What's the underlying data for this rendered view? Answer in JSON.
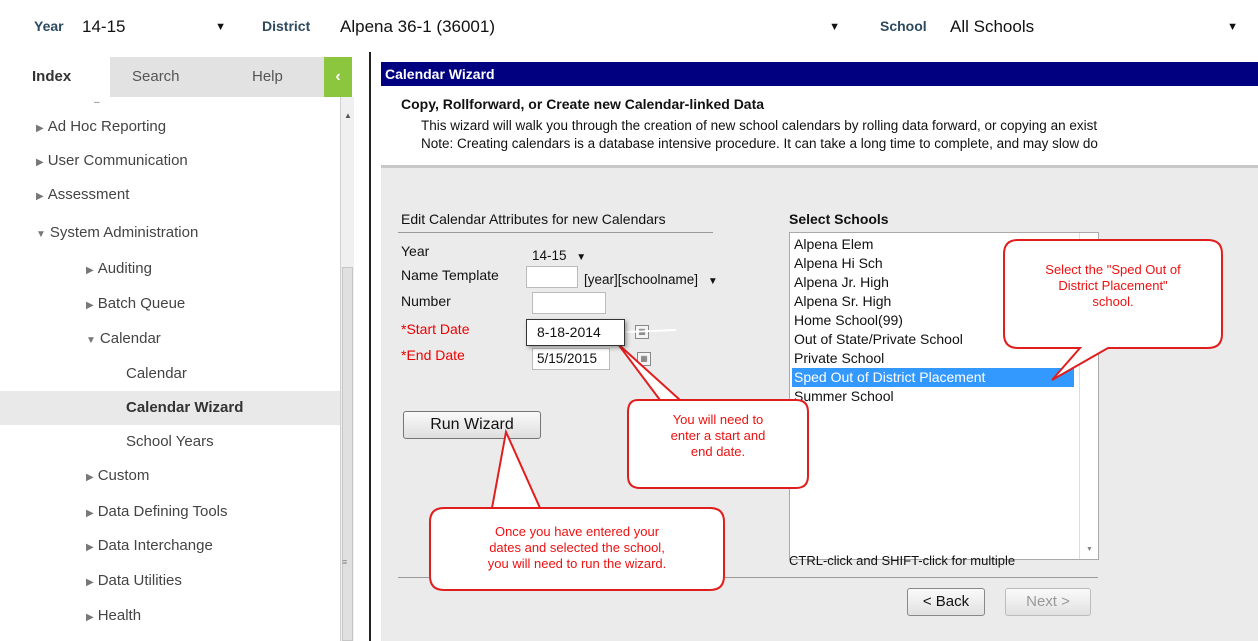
{
  "topbar": {
    "year_label": "Year",
    "year_value": "14-15",
    "district_label": "District",
    "district_value": "Alpena 36-1 (36001)",
    "school_label": "School",
    "school_value": "All Schools"
  },
  "nav_tabs": {
    "index": "Index",
    "search": "Search",
    "help": "Help",
    "collapse": "‹"
  },
  "navtree": {
    "ad_hoc": "Ad Hoc Reporting",
    "user_comm": "User Communication",
    "assessment": "Assessment",
    "sys_admin": "System Administration",
    "auditing": "Auditing",
    "batch_queue": "Batch Queue",
    "calendar_group": "Calendar",
    "calendar": "Calendar",
    "calendar_wizard": "Calendar Wizard",
    "school_years": "School Years",
    "custom": "Custom",
    "data_defining": "Data Defining Tools",
    "data_interchange": "Data Interchange",
    "data_utilities": "Data Utilities",
    "health": "Health"
  },
  "wizard": {
    "header": "Calendar Wizard",
    "intro_title": "Copy, Rollforward, or Create new Calendar-linked Data",
    "intro_line1": "This wizard will walk you through the creation of new school calendars by rolling data forward, or copying an exist",
    "intro_line2": "Note: Creating calendars is a database intensive procedure. It can take a long time to complete, and may slow do",
    "attrs_title": "Edit Calendar Attributes for new Calendars",
    "year_label": "Year",
    "year_value": "14-15",
    "name_template_label": "Name Template",
    "name_template_value": "[year][schoolname]",
    "number_label": "Number",
    "start_date_label": "*Start Date",
    "start_date_value": "8-18-2014",
    "end_date_label": "*End Date",
    "end_date_value": "5/15/2015",
    "run_button": "Run Wizard",
    "schools_title": "Select Schools",
    "schools": [
      "Alpena Elem",
      "Alpena Hi Sch",
      "Alpena Jr. High",
      "Alpena Sr. High",
      "Home School(99)",
      "Out of State/Private School",
      "Private School",
      "Sped Out of District Placement",
      "Summer School"
    ],
    "schools_hint": "CTRL-click and SHIFT-click for multiple",
    "back_button": "< Back",
    "next_button": "Next >"
  },
  "callouts": {
    "school_line1": "Select the \"Sped Out of",
    "school_line2": "District Placement\"",
    "school_line3": "school.",
    "dates_line1": "You will need to",
    "dates_line2": "enter a start and",
    "dates_line3": "end date.",
    "run_line1": "Once you have entered your",
    "run_line2": "dates and selected the school,",
    "run_line3": "you will need to run the wizard."
  },
  "colors": {
    "header_bg": "#000080",
    "accent_green": "#8cc63f",
    "selection_blue": "#3399ff",
    "callout_red": "#ee1111"
  }
}
